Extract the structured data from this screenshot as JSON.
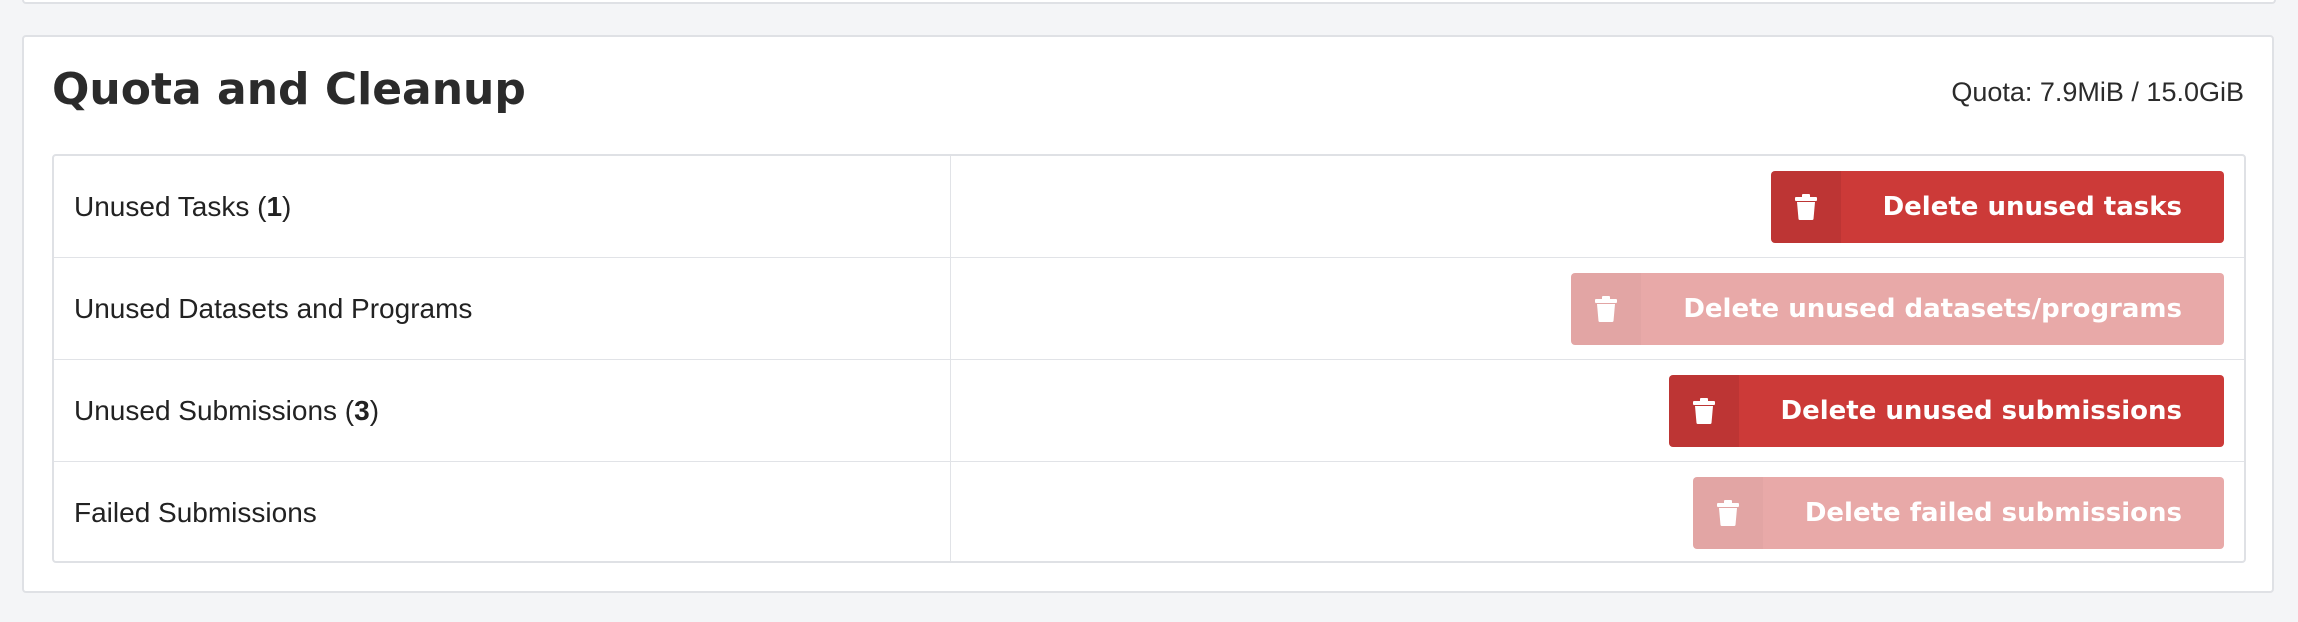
{
  "section": {
    "title": "Quota and Cleanup",
    "quota_text": "Quota: 7.9MiB / 15.0GiB"
  },
  "rows": [
    {
      "label": "Unused Tasks (",
      "count": "1",
      "suffix": ")",
      "button_label": "Delete unused tasks",
      "icon": "trash-icon",
      "enabled": true
    },
    {
      "label": "Unused Datasets and Programs",
      "count": "",
      "suffix": "",
      "button_label": "Delete unused datasets/programs",
      "icon": "trash-icon",
      "enabled": false
    },
    {
      "label": "Unused Submissions (",
      "count": "3",
      "suffix": ")",
      "button_label": "Delete unused submissions",
      "icon": "trash-icon",
      "enabled": true
    },
    {
      "label": "Failed Submissions",
      "count": "",
      "suffix": "",
      "button_label": "Delete failed submissions",
      "icon": "trash-icon",
      "enabled": false
    }
  ],
  "colors": {
    "danger": "#cc3a38",
    "danger_disabled": "#e8a9a8",
    "border": "#dfe1e5",
    "background": "#f4f5f7"
  }
}
